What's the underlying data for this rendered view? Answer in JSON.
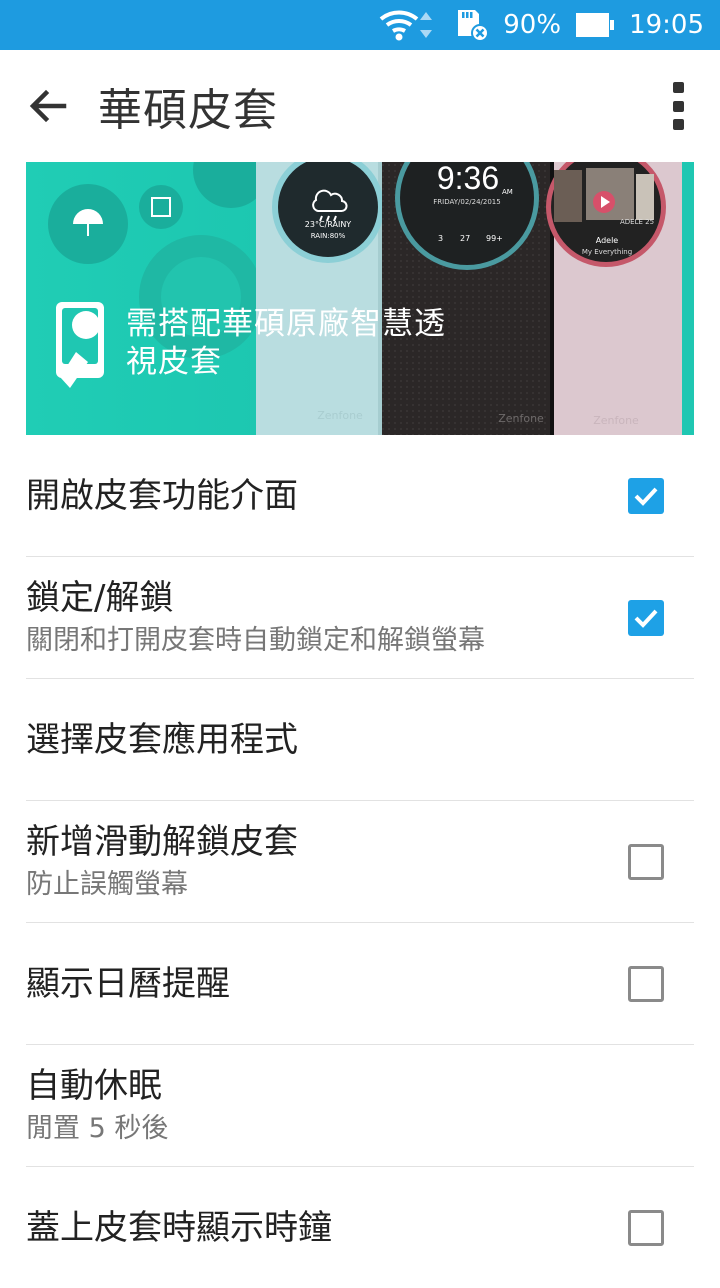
{
  "status": {
    "battery": "90%",
    "time": "19:05"
  },
  "appbar": {
    "title": "華碩皮套"
  },
  "banner": {
    "text_line1": "需搭配華碩原廠智慧透",
    "text_line2": "視皮套",
    "weather": {
      "temp": "23°C/RAINY",
      "rain": "RAIN:80%"
    },
    "clock": {
      "time": "9:36",
      "ampm": "AM",
      "date": "FRIDAY/02/24/2015",
      "counts": [
        "3",
        "27",
        "99+"
      ]
    },
    "music": {
      "artist": "Adele",
      "song": "My Everything",
      "album_text": "ADELE 25"
    },
    "brand": "Zenfone"
  },
  "settings": [
    {
      "title": "開啟皮套功能介面",
      "subtitle": "",
      "checkbox": true
    },
    {
      "title": "鎖定/解鎖",
      "subtitle": "關閉和打開皮套時自動鎖定和解鎖螢幕",
      "checkbox": true
    },
    {
      "title": "選擇皮套應用程式",
      "subtitle": "",
      "checkbox": null
    },
    {
      "title": "新增滑動解鎖皮套",
      "subtitle": "防止誤觸螢幕",
      "checkbox": false
    },
    {
      "title": "顯示日曆提醒",
      "subtitle": "",
      "checkbox": false
    },
    {
      "title": "自動休眠",
      "subtitle": "閒置 5 秒後",
      "checkbox": null
    },
    {
      "title": "蓋上皮套時顯示時鐘",
      "subtitle": "",
      "checkbox": false
    }
  ],
  "colors": {
    "status_bar": "#1e9be0",
    "accent": "#1ea1e6",
    "banner_teal": "#1fc7b2"
  }
}
